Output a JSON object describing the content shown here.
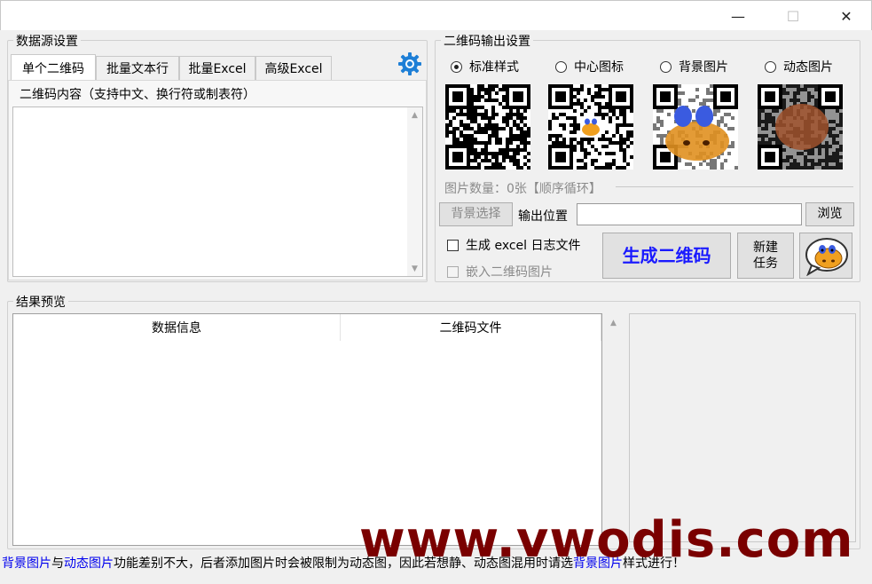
{
  "window": {
    "minimize": "—",
    "maximize": "☐",
    "close": "✕"
  },
  "datasource": {
    "title": "数据源设置",
    "tabs": [
      "单个二维码",
      "批量文本行",
      "批量Excel",
      "高级Excel"
    ],
    "content_label": "二维码内容（支持中文、换行符或制表符）",
    "content_value": ""
  },
  "output": {
    "title": "二维码输出设置",
    "styles": [
      {
        "label": "标准样式",
        "checked": true
      },
      {
        "label": "中心图标",
        "checked": false
      },
      {
        "label": "背景图片",
        "checked": false
      },
      {
        "label": "动态图片",
        "checked": false
      }
    ],
    "image_count": "图片数量：0张【顺序循环】",
    "bg_select_label": "背景选择",
    "output_location_label": "输出位置",
    "output_location_value": "",
    "browse_label": "浏览",
    "gen_excel_log_label": "生成 excel 日志文件",
    "embed_qr_label": "嵌入二维码图片",
    "generate_label": "生成二维码",
    "new_task_label": "新建\n任务"
  },
  "results": {
    "title": "结果预览",
    "columns": [
      "数据信息",
      "二维码文件"
    ]
  },
  "status": {
    "p1": "背景图片",
    "p2": "与",
    "p3": "动态图片",
    "p4": "功能差别不大，后者添加图片时会被限制为动态图，因此若想静、动态图混用时请选",
    "p5": "背景图片",
    "p6": "样式进行！"
  },
  "watermark": "www.vwodis.com",
  "colors": {
    "generate_text": "#1a1aff",
    "link_blue": "#0000ee",
    "watermark": "#7a0000",
    "gear": "#1e7fd6"
  },
  "icons": [
    "gear-icon",
    "cow-icon",
    "qr-standard",
    "qr-center-icon",
    "qr-background",
    "qr-animated"
  ]
}
